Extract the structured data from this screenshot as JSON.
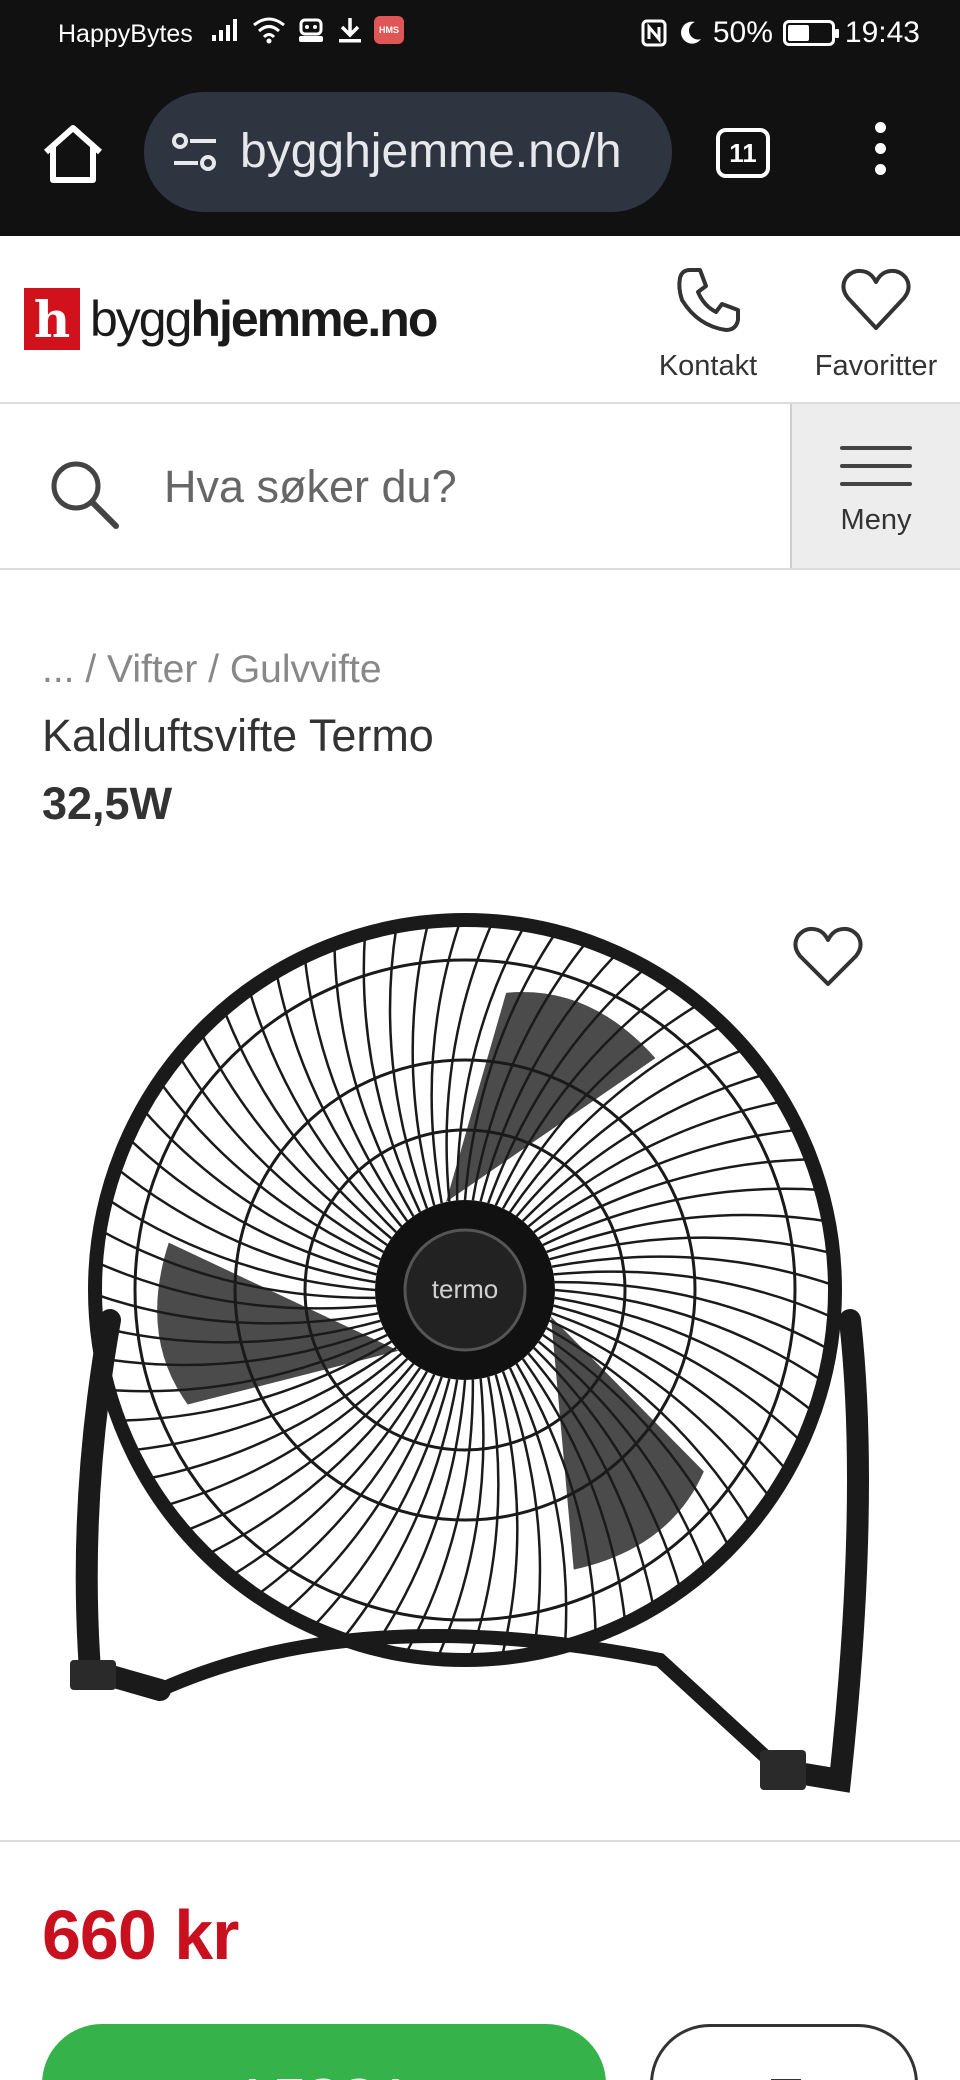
{
  "status_bar": {
    "carrier": "HappyBytes",
    "hms_badge": "HMS",
    "battery": "50%",
    "battery_level": 0.5,
    "time": "19:43"
  },
  "browser": {
    "url": "bygghjemme.no/h",
    "tab_count": "11"
  },
  "site_header": {
    "logo_mark": "h",
    "logo_text_regular": "bygg",
    "logo_text_bold": "hjemme.no",
    "contact_label": "Kontakt",
    "favorites_label": "Favoritter"
  },
  "search": {
    "placeholder": "Hva søker du?",
    "menu_label": "Meny"
  },
  "product": {
    "breadcrumb": "... / Vifter / Gulvvifte",
    "title": "Kaldluftsvifte Termo",
    "subtitle": "32,5W",
    "brand_on_image": "termo",
    "price": "660 kr",
    "add_to_cart_label": "LEGG I"
  },
  "colors": {
    "brand_red": "#d1111c",
    "price_red": "#c8101e",
    "cart_green": "#35b24a",
    "browser_dark": "#111111"
  }
}
